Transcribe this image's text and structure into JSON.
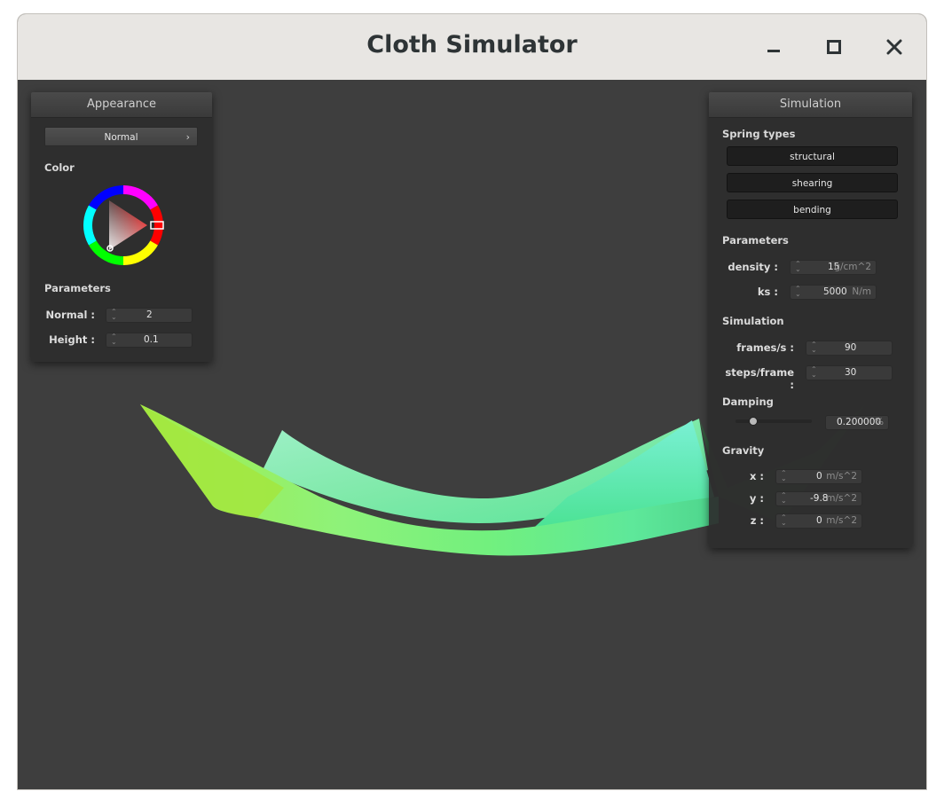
{
  "window": {
    "title": "Cloth Simulator"
  },
  "appearance": {
    "header": "Appearance",
    "shader": "Normal",
    "color_label": "Color",
    "params_label": "Parameters",
    "normal_label": "Normal :",
    "normal_value": "2",
    "height_label": "Height :",
    "height_value": "0.1"
  },
  "simulation": {
    "header": "Simulation",
    "spring_types_label": "Spring types",
    "spring_types": [
      "structural",
      "shearing",
      "bending"
    ],
    "params_label": "Parameters",
    "density_label": "density :",
    "density_value": "15",
    "density_unit": "g/cm^2",
    "ks_label": "ks :",
    "ks_value": "5000",
    "ks_unit": "N/m",
    "sim_label": "Simulation",
    "fps_label": "frames/s :",
    "fps_value": "90",
    "steps_label": "steps/frame :",
    "steps_value": "30",
    "damping_label": "Damping",
    "damping_value": "0.200000",
    "damping_unit": "%",
    "damping_slider_fraction": 0.2,
    "gravity_label": "Gravity",
    "gx_label": "x :",
    "gx_value": "0",
    "gy_label": "y :",
    "gy_value": "-9.8",
    "gz_label": "z :",
    "gz_value": "0",
    "gravity_unit": "m/s^2"
  },
  "colors": {
    "viewport_bg": "#3e3e3e",
    "cloth_green": "#8cf06a",
    "cloth_cyan": "#7eeac2",
    "selected_color": "#e03030"
  }
}
